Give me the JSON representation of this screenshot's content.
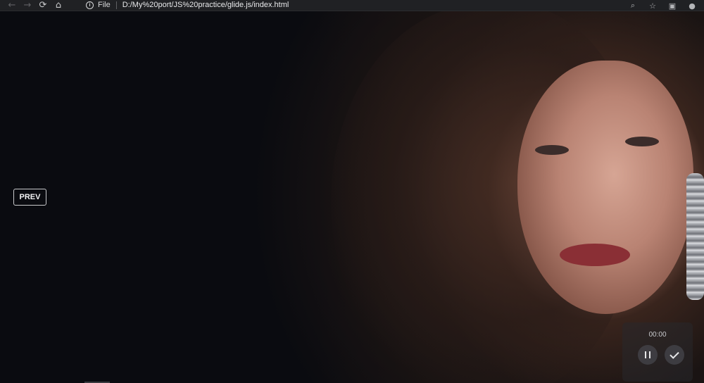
{
  "browser": {
    "nav": {
      "back_icon": "arrow-left-icon",
      "forward_icon": "arrow-right-icon",
      "reload_icon": "reload-icon",
      "home_icon": "home-icon"
    },
    "address_bar": {
      "scheme_label": "File",
      "url": "D:/My%20port/JS%20practice/glide.js/index.html"
    },
    "right_icons": [
      "search-icon",
      "star-icon",
      "extension-icon",
      "profile-icon"
    ]
  },
  "slider": {
    "prev_label": "PREV"
  },
  "recorder": {
    "time": "00:00",
    "pause_icon": "pause-icon",
    "done_icon": "check-icon"
  }
}
